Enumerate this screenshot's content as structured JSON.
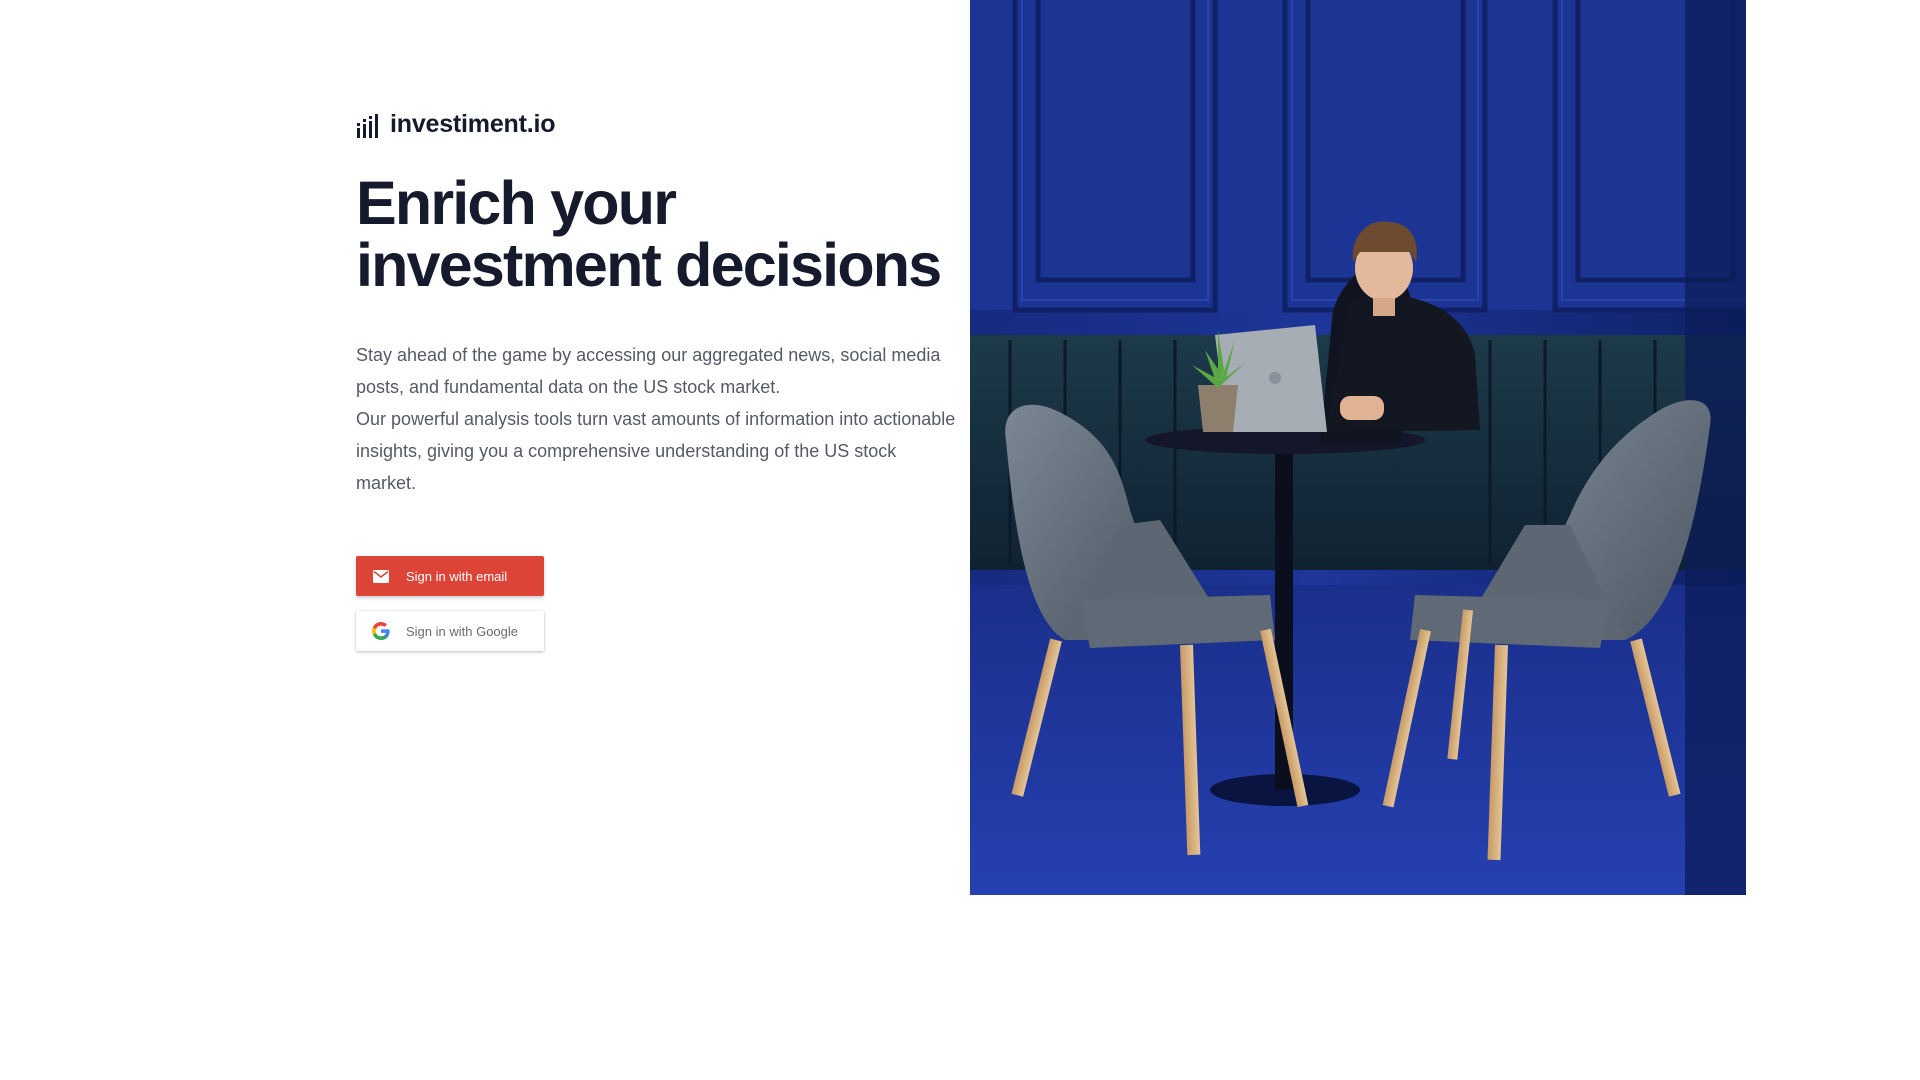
{
  "brand": {
    "name": "investiment.io",
    "icon": "bar-chart-icon"
  },
  "hero": {
    "headline": "Enrich your investment decisions",
    "paragraph_1": "Stay ahead of the game by accessing our aggregated news, social media posts, and fundamental data on the US stock market.",
    "paragraph_2": "Our powerful analysis tools turn vast amounts of information into actionable insights, giving you a comprehensive understanding of the US stock market."
  },
  "auth": {
    "email_label": "Sign in with email",
    "email_icon": "mail-icon",
    "google_label": "Sign in with Google",
    "google_icon": "google-logo-icon"
  },
  "colors": {
    "email_button": "#db4437",
    "heading": "#151a2c",
    "body_text": "#555a66",
    "photo_wall": "#1d3596"
  }
}
